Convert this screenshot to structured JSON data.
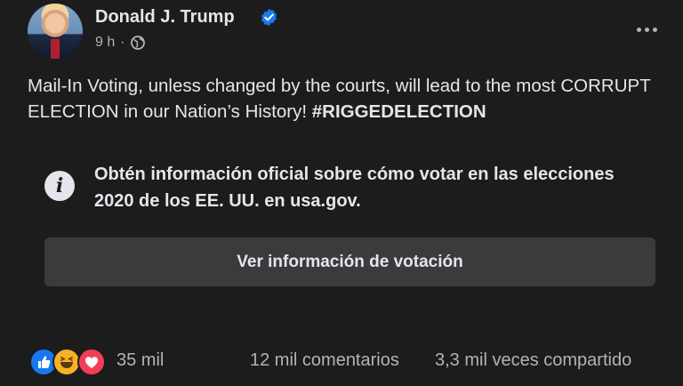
{
  "post": {
    "author": "Donald J. Trump",
    "time": "9 h",
    "separator": "·",
    "text_main": "Mail-In Voting, unless changed by the courts, will lead to the most CORRUPT ELECTION in our Nation’s History! ",
    "hashtag": "#RIGGEDELECTION"
  },
  "info_panel": {
    "icon_glyph": "i",
    "text": "Obtén información oficial sobre cómo votar en las elecciones 2020 de los EE. UU. en usa.gov.",
    "button_label": "Ver información de votación"
  },
  "footer": {
    "reaction_count": "35 mil",
    "comments": "12 mil comentarios",
    "shares": "3,3 mil veces compartido"
  },
  "icons": [
    "verified-badge-icon",
    "globe-icon",
    "more-options-icon",
    "info-icon",
    "like-reaction-icon",
    "haha-reaction-icon",
    "love-reaction-icon"
  ],
  "colors": {
    "background": "#1c1c1d",
    "text": "#e4e6eb",
    "secondary_text": "#b0b3b8",
    "button_bg": "#3a3b3c",
    "verified": "#1877f2",
    "like": "#1877f2",
    "haha": "#f7b125",
    "love": "#f33e58"
  }
}
